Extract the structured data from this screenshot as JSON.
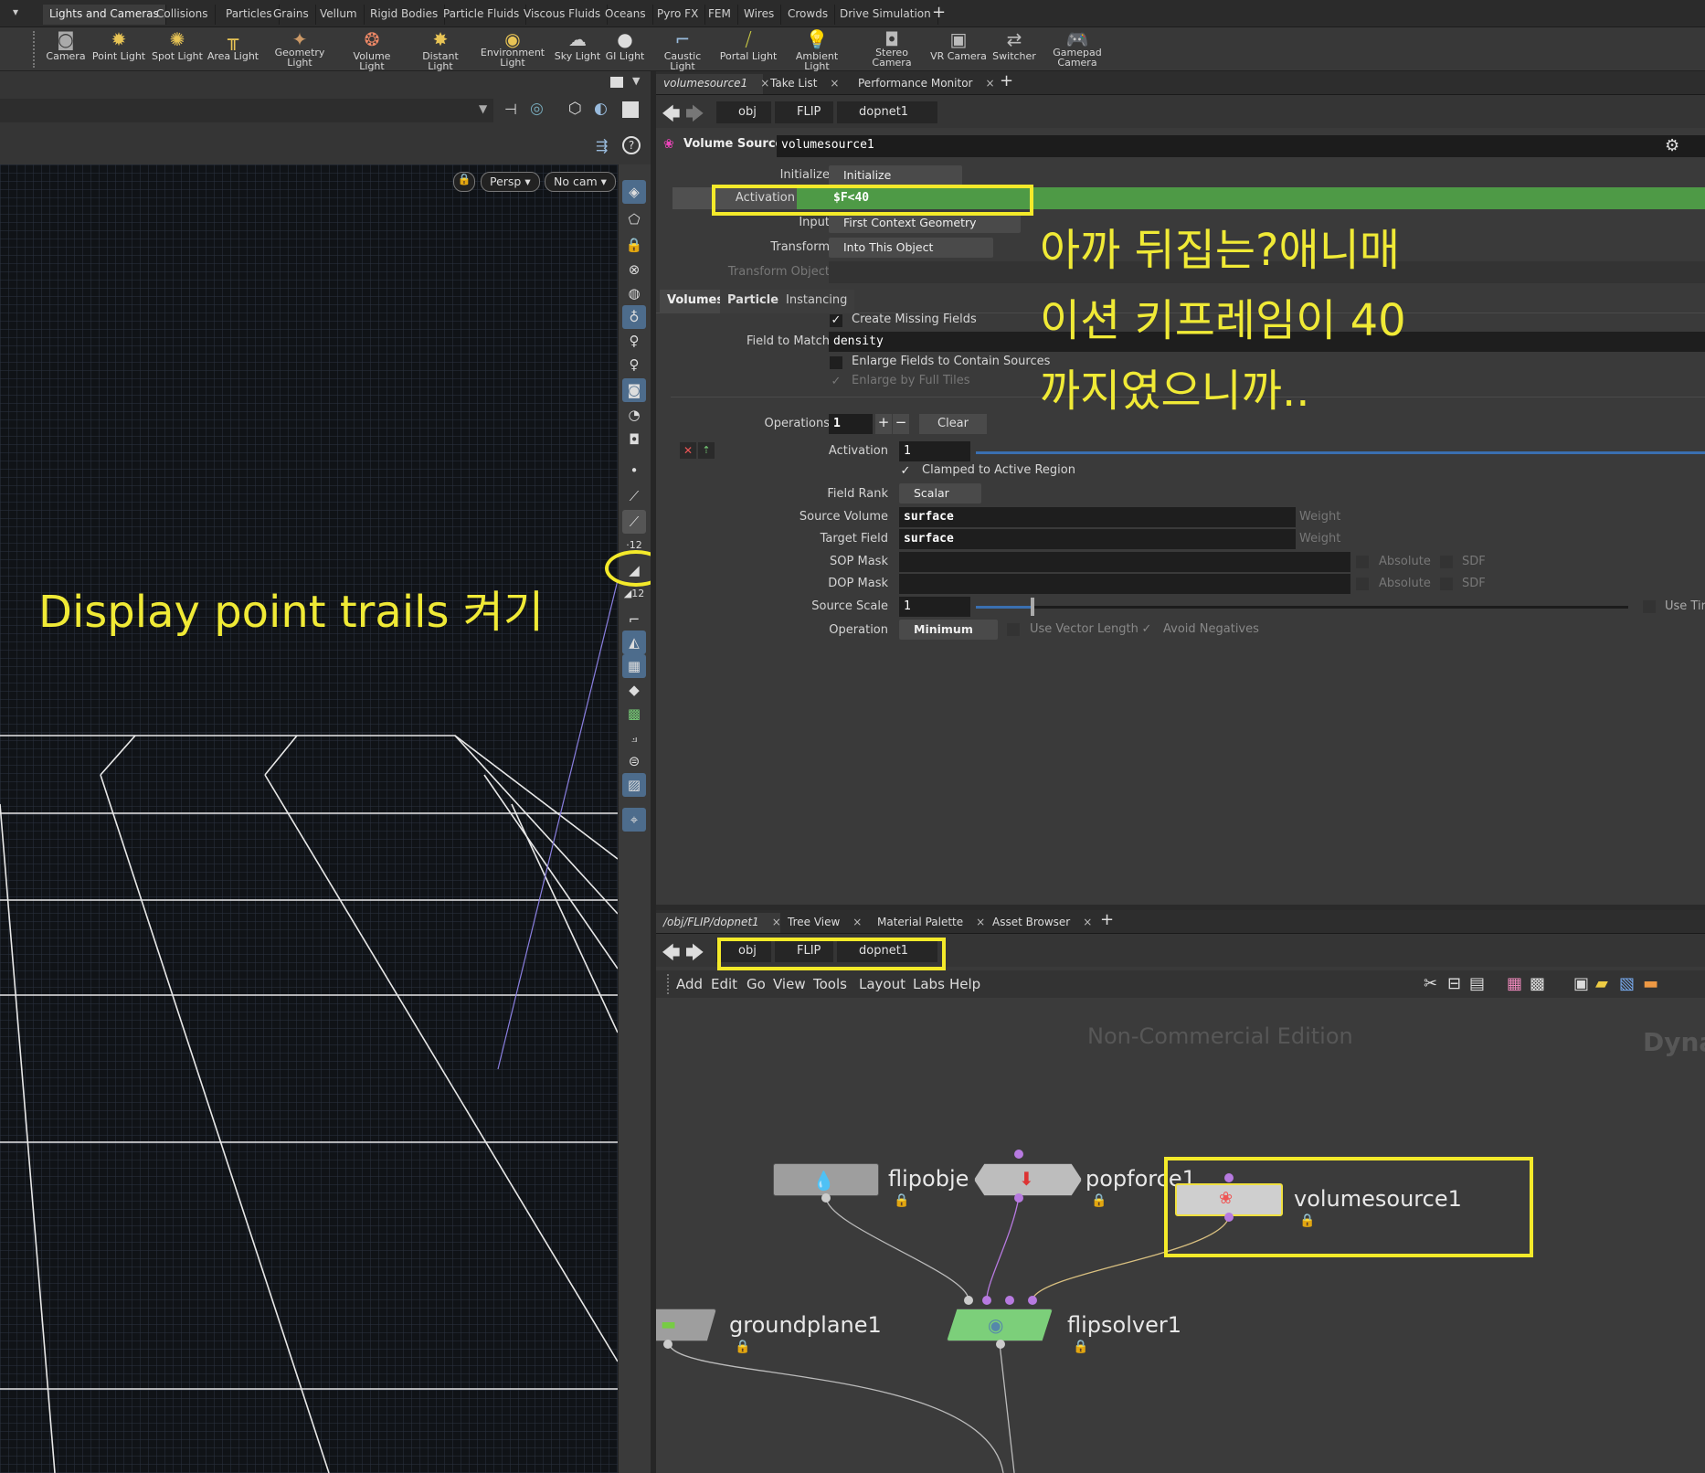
{
  "shelf": {
    "dropdown": "▾",
    "tabs": [
      "Lights and Cameras",
      "Collisions",
      "Particles",
      "Grains",
      "Vellum",
      "Rigid Bodies",
      "Particle Fluids",
      "Viscous Fluids",
      "Oceans",
      "Pyro FX",
      "FEM",
      "Wires",
      "Crowds",
      "Drive Simulation"
    ],
    "add_tab": "+",
    "tools": [
      "Camera",
      "Point Light",
      "Spot Light",
      "Area Light",
      "Geometry Light",
      "Volume Light",
      "Distant Light",
      "Environment Light",
      "Sky Light",
      "GI Light",
      "Caustic Light",
      "Portal Light",
      "Ambient Light",
      "Stereo Camera",
      "VR Camera",
      "Switcher",
      "Gamepad Camera"
    ]
  },
  "viewport": {
    "persp": "Persp ▾",
    "cam": "No cam ▾",
    "annotation": "Display point trails 켜기"
  },
  "params_pane": {
    "tabs": [
      {
        "label": "volumesource1",
        "close": "×"
      },
      {
        "label": "Take List",
        "close": "×"
      },
      {
        "label": "Performance Monitor",
        "close": "×"
      }
    ],
    "add": "+",
    "path": [
      "obj",
      "FLIP",
      "dopnet1"
    ],
    "node_type": "Volume Source",
    "node_name": "volumesource1",
    "initialize_label": "Initialize",
    "initialize_value": "Initialize",
    "activation_label": "Activation",
    "activation_value": "$F<40",
    "input_label": "Input",
    "input_value": "First Context Geometry",
    "transform_label": "Transform",
    "transform_value": "Into This Object",
    "transform_object_label": "Transform Object",
    "subtabs": [
      "Volumes",
      "Particles",
      "Instancing"
    ],
    "create_missing": "Create Missing Fields",
    "field_to_match_label": "Field to Match",
    "field_to_match_value": "density",
    "enlarge_fields": "Enlarge Fields to Contain Sources",
    "enlarge_full": "Enlarge by Full Tiles",
    "operations_label": "Operations",
    "operations_value": "1",
    "plus": "+",
    "minus": "−",
    "clear": "Clear",
    "op_activation_label": "Activation",
    "op_activation_value": "1",
    "clamped": "Clamped to Active Region",
    "field_rank_label": "Field Rank",
    "field_rank_value": "Scalar",
    "source_volume_label": "Source Volume",
    "source_volume_value": "surface",
    "target_field_label": "Target Field",
    "target_field_value": "surface",
    "weight": "Weight",
    "sop_mask_label": "SOP Mask",
    "dop_mask_label": "DOP Mask",
    "absolute": "Absolute",
    "sdf": "SDF",
    "source_scale_label": "Source Scale",
    "source_scale_value": "1",
    "use_time": "Use Tir",
    "operation_label": "Operation",
    "operation_value": "Minimum",
    "use_vector_length": "Use Vector Length",
    "avoid_negatives": "Avoid Negatives",
    "note_lines": [
      "아까 뒤집는?애니매",
      "이션 키프레임이 40",
      "까지였으니까.."
    ]
  },
  "network_pane": {
    "tabs": [
      {
        "label": "/obj/FLIP/dopnet1",
        "close": "×"
      },
      {
        "label": "Tree View",
        "close": "×"
      },
      {
        "label": "Material Palette",
        "close": "×"
      },
      {
        "label": "Asset Browser",
        "close": "×"
      }
    ],
    "add": "+",
    "path": [
      "obj",
      "FLIP",
      "dopnet1"
    ],
    "menu": [
      "Add",
      "Edit",
      "Go",
      "View",
      "Tools",
      "Layout",
      "Labs",
      "Help"
    ],
    "watermark": "Non-Commercial Edition",
    "context_label": "Dyna",
    "nodes": [
      "flipobje",
      "popforce1",
      "volumesource1",
      "groundplane1",
      "flipsolver1"
    ]
  }
}
